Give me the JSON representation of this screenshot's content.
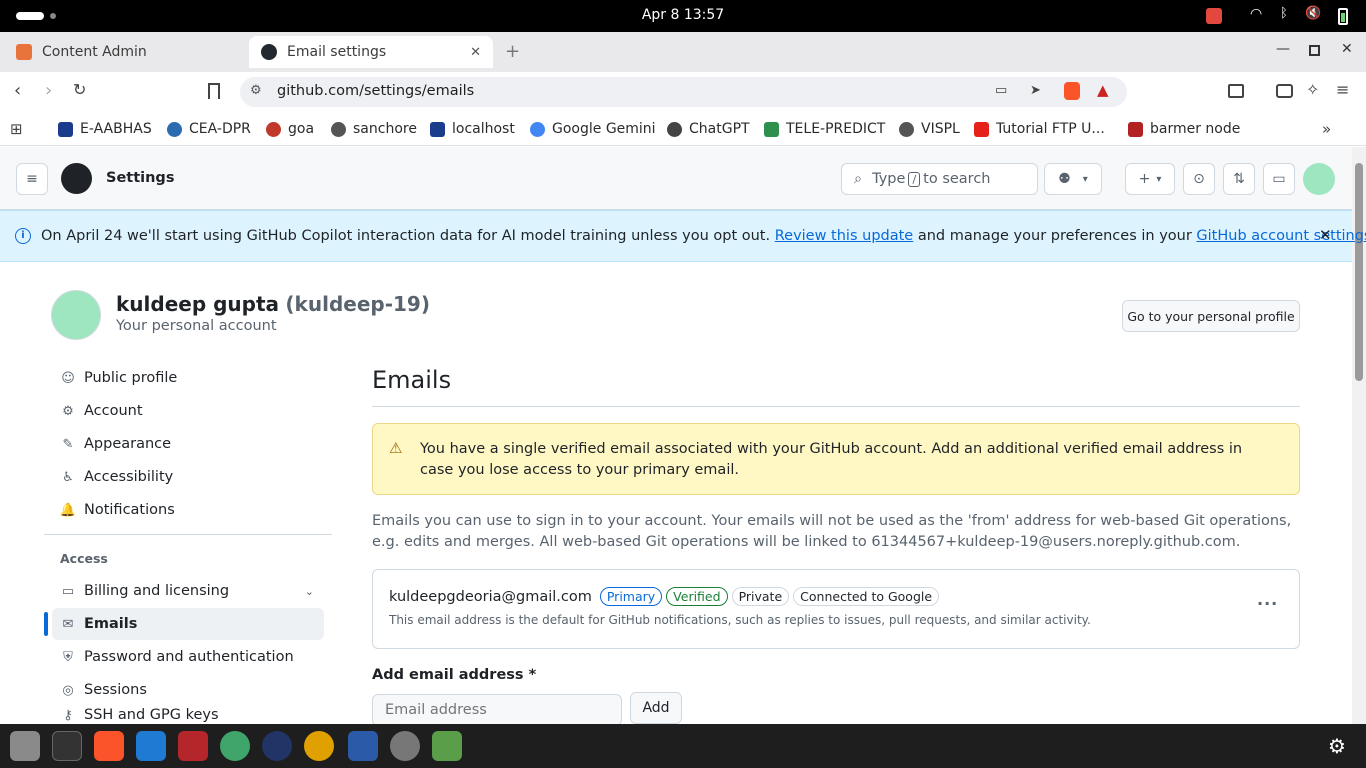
{
  "system": {
    "clock": "Apr 8  13:57"
  },
  "tabs": [
    {
      "label": "Content Admin"
    },
    {
      "label": "Email settings"
    }
  ],
  "url": "github.com/settings/emails",
  "bookmarks": [
    "E-AABHAS",
    "CEA-DPR",
    "goa",
    "sanchore",
    "localhost",
    "Google Gemini",
    "ChatGPT",
    "TELE-PREDICT",
    "VISPL",
    "Tutorial FTP U...",
    "barmer node"
  ],
  "header": {
    "title": "Settings",
    "search_placeholder": "Type",
    "search_key": "/",
    "search_suffix": "to search"
  },
  "banner": {
    "text1": "On April 24 we'll start using GitHub Copilot interaction data for AI model training unless you opt out.",
    "link1": "Review this update",
    "text2": "and manage your preferences in your",
    "link2": "GitHub account settings",
    "text3": "."
  },
  "user": {
    "name": "kuldeep gupta",
    "handle": "(kuldeep-19)",
    "subtitle": "Your personal account",
    "profile_button": "Go to your personal profile"
  },
  "sidebar": {
    "items": [
      "Public profile",
      "Account",
      "Appearance",
      "Accessibility",
      "Notifications"
    ],
    "section": "Access",
    "access_items": [
      "Billing and licensing",
      "Emails",
      "Password and authentication",
      "Sessions",
      "SSH and GPG keys"
    ]
  },
  "main": {
    "title": "Emails",
    "warning": "You have a single verified email associated with your GitHub account. Add an additional verified email address in case you lose access to your primary email.",
    "description": "Emails you can use to sign in to your account. Your emails will not be used as the 'from' address for web-based Git operations, e.g. edits and merges. All web-based Git operations will be linked to 61344567+kuldeep-19@users.noreply.github.com.",
    "email": {
      "address": "kuldeepgdeoria@gmail.com",
      "badges": [
        "Primary",
        "Verified",
        "Private",
        "Connected to Google"
      ],
      "note": "This email address is the default for GitHub notifications, such as replies to issues, pull requests, and similar activity.",
      "menu": "..."
    },
    "add_label": "Add email address *",
    "add_placeholder": "Email address",
    "add_button": "Add"
  },
  "colors": {
    "accent": "#0969da",
    "warning_bg": "#fff8c5",
    "banner_bg": "#ddf4ff",
    "verified": "#1a7f37"
  }
}
